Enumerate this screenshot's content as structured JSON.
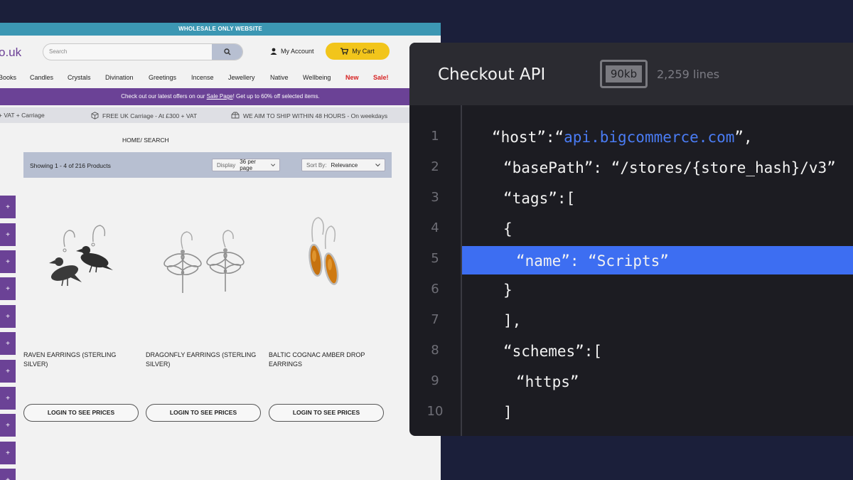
{
  "store": {
    "top_banner": "WHOLESALE ONLY WEBSITE",
    "logo_text": "o.uk",
    "search_placeholder": "Search",
    "account_label": "My Account",
    "cart_label": "My Cart",
    "nav": [
      "Books",
      "Candles",
      "Crystals",
      "Divination",
      "Greetings",
      "Incense",
      "Jewellery",
      "Native",
      "Wellbeing",
      "New",
      "Sale!"
    ],
    "promo": {
      "before": "Check out our latest offers on our ",
      "link": "Sale Page",
      "after": "! Get up to 60% off selected items."
    },
    "shipping": [
      "+ VAT + Carriage",
      "FREE UK Carriage - At £300 + VAT",
      "WE AIM TO SHIP WITHIN 48 HOURS - On weekdays"
    ],
    "breadcrumb": "HOME/ SEARCH",
    "showing": "Showing 1 - 4 of 216 Products",
    "display_label": "Display",
    "display_value": "36 per page",
    "sort_label": "Sort By:",
    "sort_value": "Relevance",
    "side_button_label": "+",
    "products": [
      {
        "name": "RAVEN EARRINGS (STERLING SILVER)",
        "button": "LOGIN TO SEE PRICES"
      },
      {
        "name": "DRAGONFLY EARRINGS (STERLING SILVER)",
        "button": "LOGIN TO SEE PRICES"
      },
      {
        "name": "BALTIC COGNAC AMBER DROP EARRINGS",
        "button": "LOGIN TO SEE PRICES"
      }
    ]
  },
  "code_panel": {
    "title": "Checkout API",
    "size": "90kb",
    "lines_count": "2,259 lines",
    "line_numbers": [
      "1",
      "2",
      "3",
      "4",
      "5",
      "6",
      "7",
      "8",
      "9",
      "10"
    ],
    "lines": [
      {
        "pre": "“host”:“",
        "str": "api.bigcommerce.com",
        "post": "”,"
      },
      {
        "pre": "“basePath”: “/stores/{store_hash}/v3”",
        "str": "",
        "post": ""
      },
      {
        "pre": "“tags”:[",
        "str": "",
        "post": ""
      },
      {
        "pre": "{",
        "str": "",
        "post": ""
      },
      {
        "pre": "“name”: “Scripts”",
        "str": "",
        "post": ""
      },
      {
        "pre": "}",
        "str": "",
        "post": ""
      },
      {
        "pre": "],",
        "str": "",
        "post": ""
      },
      {
        "pre": "“schemes”:[",
        "str": "",
        "post": ""
      },
      {
        "pre": "“https”",
        "str": "",
        "post": ""
      },
      {
        "pre": "]",
        "str": "",
        "post": ""
      }
    ],
    "highlighted_line": 5
  },
  "colors": {
    "background": "#1b1f3a",
    "brand_purple": "#6b4296",
    "banner_teal": "#3c97b3",
    "cart_yellow": "#f2c51b",
    "code_highlight": "#3d6ef2"
  }
}
